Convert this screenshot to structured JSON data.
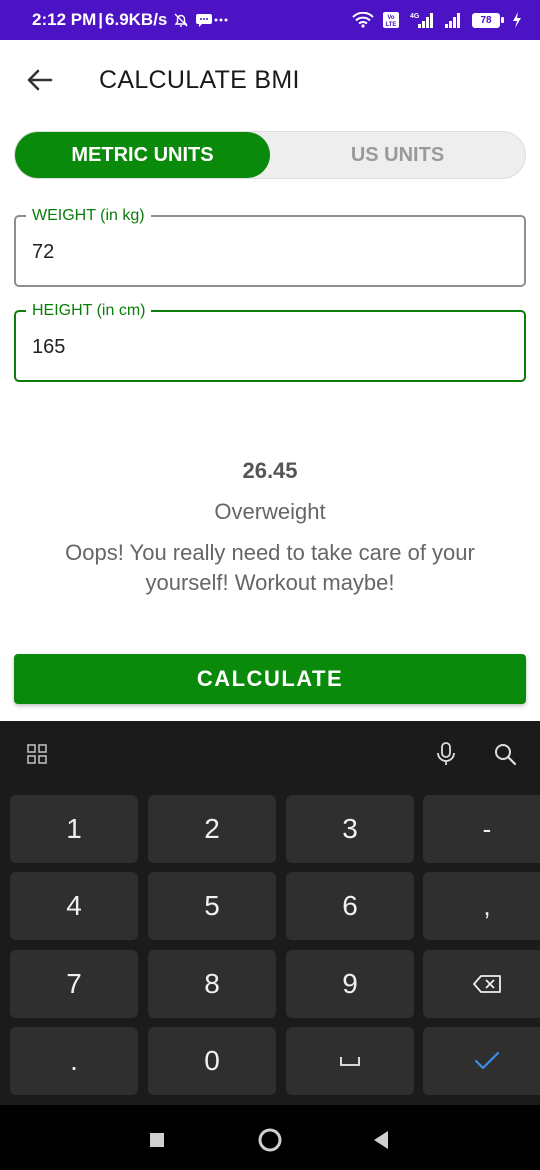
{
  "status_bar": {
    "time": "2:12 PM",
    "separator": "|",
    "net_speed": "6.9KB/s",
    "network_label": "4G",
    "volte_label": "Vo LTE",
    "battery_level": "78",
    "bg_color": "#4b13c4"
  },
  "app_bar": {
    "title": "CALCULATE BMI",
    "back_icon": "arrow-left-icon"
  },
  "units_toggle": {
    "metric_label": "METRIC UNITS",
    "us_label": "US UNITS",
    "selected": "metric",
    "accent_color": "#0a8a0a"
  },
  "form": {
    "weight_label": "WEIGHT (in kg)",
    "weight_value": "72",
    "height_label": "HEIGHT (in cm)",
    "height_value": "165"
  },
  "result": {
    "bmi_value": "26.45",
    "category": "Overweight",
    "message": "Oops! You really need to take care of your yourself! Workout maybe!"
  },
  "calculate_button": {
    "label": "CALCULATE"
  },
  "keyboard": {
    "toolbar_icons": [
      "grid-icon",
      "microphone-icon",
      "search-icon"
    ],
    "keys": [
      {
        "name": "key-1",
        "label": "1"
      },
      {
        "name": "key-2",
        "label": "2"
      },
      {
        "name": "key-3",
        "label": "3"
      },
      {
        "name": "key-minus",
        "label": "-"
      },
      {
        "name": "key-4",
        "label": "4"
      },
      {
        "name": "key-5",
        "label": "5"
      },
      {
        "name": "key-6",
        "label": "6"
      },
      {
        "name": "key-comma",
        "label": ","
      },
      {
        "name": "key-7",
        "label": "7"
      },
      {
        "name": "key-8",
        "label": "8"
      },
      {
        "name": "key-9",
        "label": "9"
      },
      {
        "name": "key-backspace",
        "icon": "backspace-icon"
      },
      {
        "name": "key-period",
        "label": "."
      },
      {
        "name": "key-0",
        "label": "0"
      },
      {
        "name": "key-space",
        "icon": "space-icon"
      },
      {
        "name": "key-done",
        "icon": "checkmark-icon"
      }
    ]
  },
  "nav_bar": {
    "icons": [
      "recents-square-icon",
      "home-circle-icon",
      "back-triangle-icon"
    ]
  }
}
